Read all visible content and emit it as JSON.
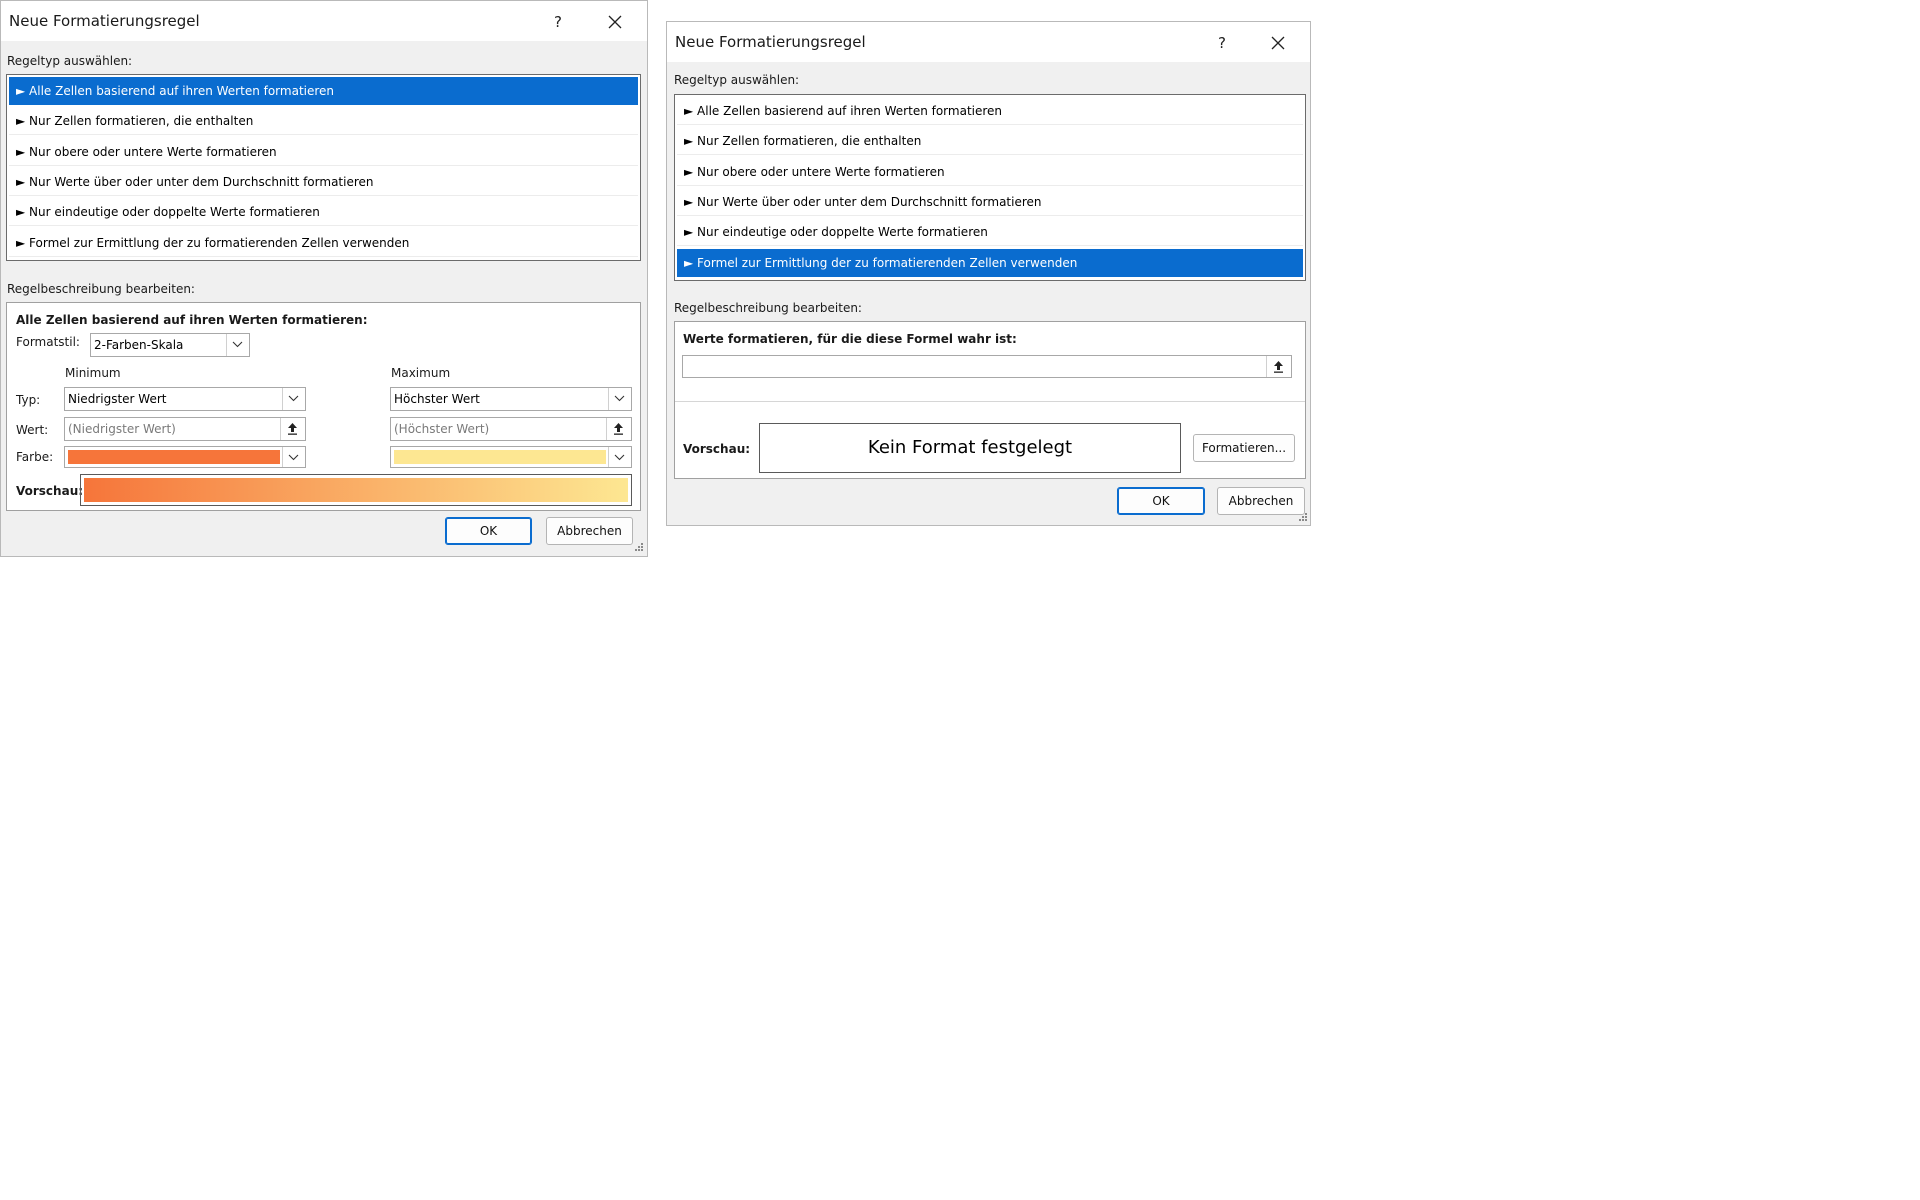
{
  "colors": {
    "selection": "#0a6ccf",
    "minimum_color": "#f6753a",
    "maximum_color": "#fde792",
    "gradient_start": "#f6753a",
    "gradient_end": "#fde792"
  },
  "icons": {
    "help": "question-mark-icon",
    "close": "close-x-icon",
    "dropdown": "chevron-down-icon",
    "range_picker": "upload-arrow-icon",
    "rule_marker": "triangle-right-icon"
  },
  "left_dialog": {
    "title": "Neue Formatierungsregel",
    "help_label": "?",
    "rule_type_label": "Regeltyp auswählen:",
    "rule_types": [
      "► Alle Zellen basierend auf ihren Werten formatieren",
      "► Nur Zellen formatieren, die enthalten",
      "► Nur obere oder untere Werte formatieren",
      "► Nur Werte über oder unter dem Durchschnitt formatieren",
      "► Nur eindeutige oder doppelte Werte formatieren",
      "► Formel zur Ermittlung der zu formatierenden Zellen verwenden"
    ],
    "selected_rule_index": 0,
    "description_label": "Regelbeschreibung bearbeiten:",
    "description_heading": "Alle Zellen basierend auf ihren Werten formatieren:",
    "format_style_label": "Formatstil:",
    "format_style_value": "2-Farben-Skala",
    "minimum_label": "Minimum",
    "maximum_label": "Maximum",
    "type_label": "Typ:",
    "value_label": "Wert:",
    "color_label": "Farbe:",
    "min_type": "Niedrigster Wert",
    "max_type": "Höchster Wert",
    "min_value_placeholder": "(Niedrigster Wert)",
    "max_value_placeholder": "(Höchster Wert)",
    "preview_label": "Vorschau:",
    "ok_label": "OK",
    "cancel_label": "Abbrechen"
  },
  "right_dialog": {
    "title": "Neue Formatierungsregel",
    "help_label": "?",
    "rule_type_label": "Regeltyp auswählen:",
    "rule_types": [
      "► Alle Zellen basierend auf ihren Werten formatieren",
      "► Nur Zellen formatieren, die enthalten",
      "► Nur obere oder untere Werte formatieren",
      "► Nur Werte über oder unter dem Durchschnitt formatieren",
      "► Nur eindeutige oder doppelte Werte formatieren",
      "► Formel zur Ermittlung der zu formatierenden Zellen verwenden"
    ],
    "selected_rule_index": 5,
    "description_label": "Regelbeschreibung bearbeiten:",
    "formula_heading": "Werte formatieren, für die diese Formel wahr ist:",
    "formula_value": "",
    "preview_label": "Vorschau:",
    "preview_text": "Kein Format festgelegt",
    "format_button_label": "Formatieren...",
    "ok_label": "OK",
    "cancel_label": "Abbrechen"
  }
}
